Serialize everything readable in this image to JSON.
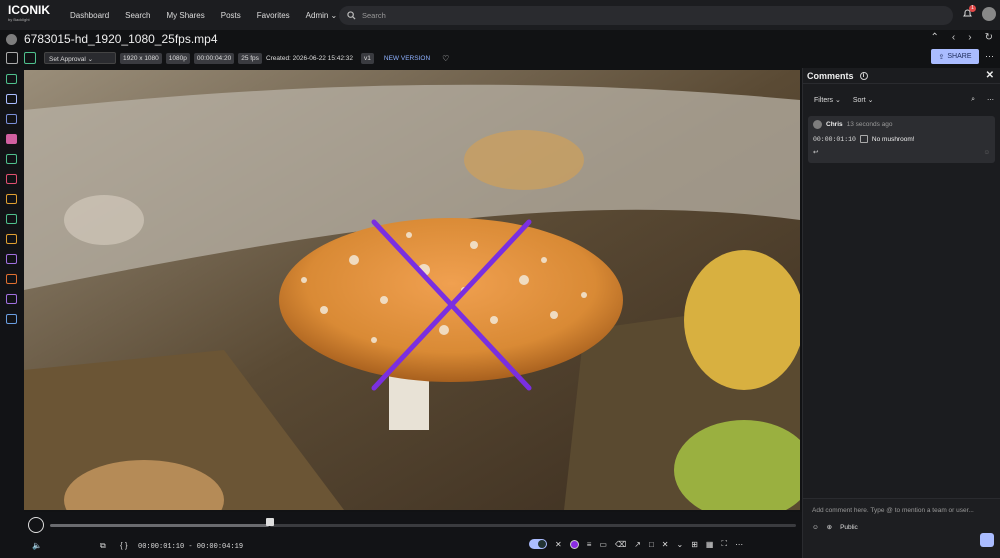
{
  "brand": {
    "name": "ICONIK",
    "sub": "by Backlight"
  },
  "nav": [
    "Dashboard",
    "Search",
    "My Shares",
    "Posts",
    "Favorites",
    "Admin ⌄"
  ],
  "search": {
    "placeholder": "Search"
  },
  "notifications": {
    "count": "1"
  },
  "asset": {
    "title": "6783015-hd_1920_1080_25fps.mp4"
  },
  "toolbar": {
    "approval": "Set Approval ⌄",
    "tags": [
      "1920 x 1080",
      "1080p",
      "00:00:04:20",
      "25 fps"
    ],
    "created": "Created: 2026-06-22 15:42:32",
    "version": "v1",
    "new_version": "NEW VERSION",
    "share": "SHARE"
  },
  "comments": {
    "header": "Comments",
    "filters": "Filters ⌄",
    "sort": "Sort ⌄",
    "items": [
      {
        "author": "Chris",
        "time": "13 seconds ago",
        "timecode": "00:00:01:10",
        "text": "No mushroom!"
      }
    ],
    "compose_placeholder": "Add comment here. Type @ to mention a team or user...",
    "visibility": "Public"
  },
  "player": {
    "timecode": "00:00:01:10 - 00:00:04:19"
  },
  "colors": {
    "accent": "#aabcff",
    "annotation": "#7a2fe0",
    "cap": "#e0903a"
  }
}
